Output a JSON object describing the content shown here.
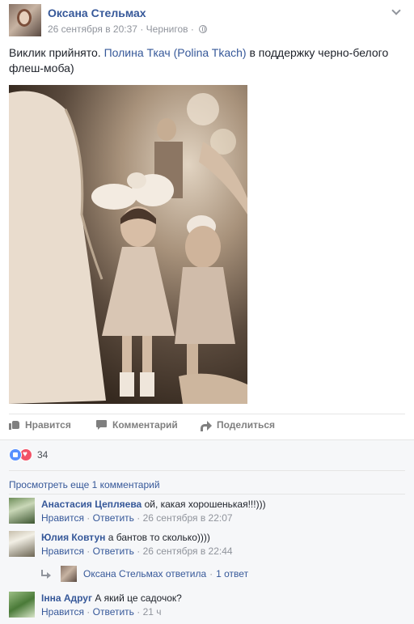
{
  "post": {
    "author": "Оксана Стельмах",
    "date": "26 сентября в 20:37",
    "separator": "·",
    "location": "Чернигов",
    "dot": "·",
    "text_prefix": "Виклик прийнято. ",
    "tag_link": "Полина Ткач (Polina Tkach)",
    "text_suffix": " в поддержку черно-белого флеш-моба)"
  },
  "actions": {
    "like": "Нравится",
    "comment": "Комментарий",
    "share": "Поделиться"
  },
  "reactions": {
    "count": "34"
  },
  "more_comments": "Просмотреть еще 1 комментарий",
  "comments": [
    {
      "name": "Анастасия Цепляева",
      "text": "ой, какая хорошенькая!!!)))",
      "like": "Нравится",
      "dot1": "·",
      "reply": "Ответить",
      "dot2": "·",
      "time": "26 сентября в 22:07"
    },
    {
      "name": "Юлия Ковтун",
      "text": "а бантов то сколько))))",
      "like": "Нравится",
      "dot1": "·",
      "reply": "Ответить",
      "dot2": "·",
      "time": "26 сентября в 22:44"
    },
    {
      "name": "Інна Адруг",
      "text": "А який це садочок?",
      "like": "Нравится",
      "dot1": "·",
      "reply": "Ответить",
      "dot2": "·",
      "time": "21 ч"
    }
  ],
  "reply_summary": {
    "text": "Оксана Стельмах ответила",
    "dot": "·",
    "count": "1 ответ"
  },
  "colors": {
    "link": "#365899",
    "meta": "#90949c",
    "like_reaction": "#5890ff",
    "love_reaction": "#f25268"
  }
}
